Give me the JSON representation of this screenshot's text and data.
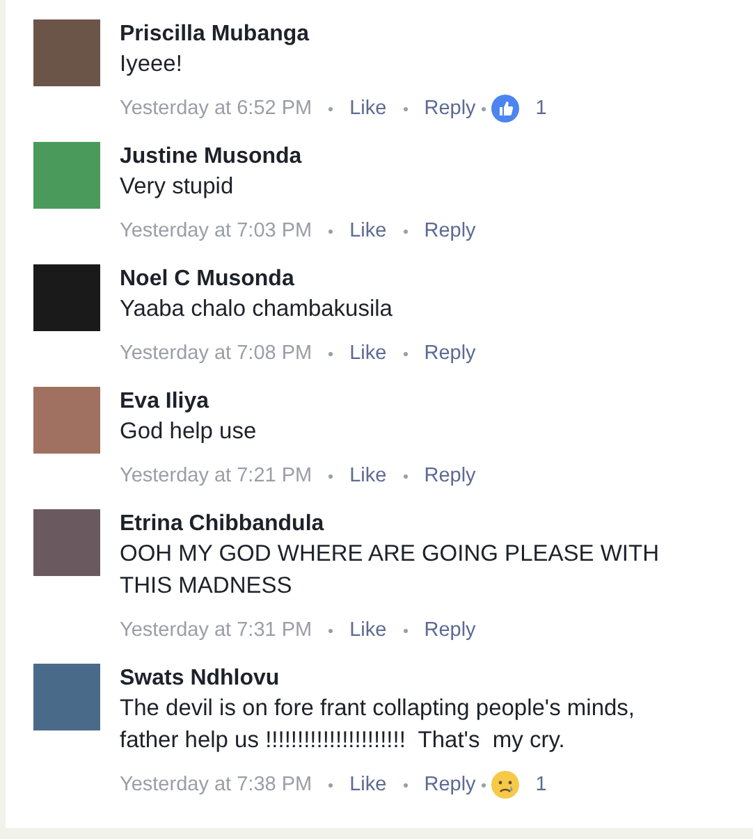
{
  "comments": [
    {
      "name": "Priscilla Mubanga",
      "text": "Iyeee!",
      "time": "Yesterday at 6:52 PM",
      "like": "Like",
      "reply": "Reply",
      "reaction": {
        "kind": "like",
        "count": "1"
      }
    },
    {
      "name": "Justine Musonda",
      "text": "Very stupid",
      "time": "Yesterday at 7:03 PM",
      "like": "Like",
      "reply": "Reply"
    },
    {
      "name": "Noel C Musonda",
      "text": "Yaaba chalo chambakusila",
      "time": "Yesterday at 7:08 PM",
      "like": "Like",
      "reply": "Reply"
    },
    {
      "name": "Eva Iliya",
      "text": "God help use",
      "time": "Yesterday at 7:21 PM",
      "like": "Like",
      "reply": "Reply"
    },
    {
      "name": "Etrina Chibbandula",
      "text": "OOH MY GOD WHERE ARE GOING PLEASE WITH THIS MADNESS",
      "time": "Yesterday at 7:31 PM",
      "like": "Like",
      "reply": "Reply"
    },
    {
      "name": "Swats Ndhlovu",
      "text": "The devil is on fore frant collapting people's minds, father help us !!!!!!!!!!!!!!!!!!!!!!  That's  my cry.",
      "time": "Yesterday at 7:38 PM",
      "like": "Like",
      "reply": "Reply",
      "reaction": {
        "kind": "sad",
        "count": "1"
      }
    }
  ]
}
